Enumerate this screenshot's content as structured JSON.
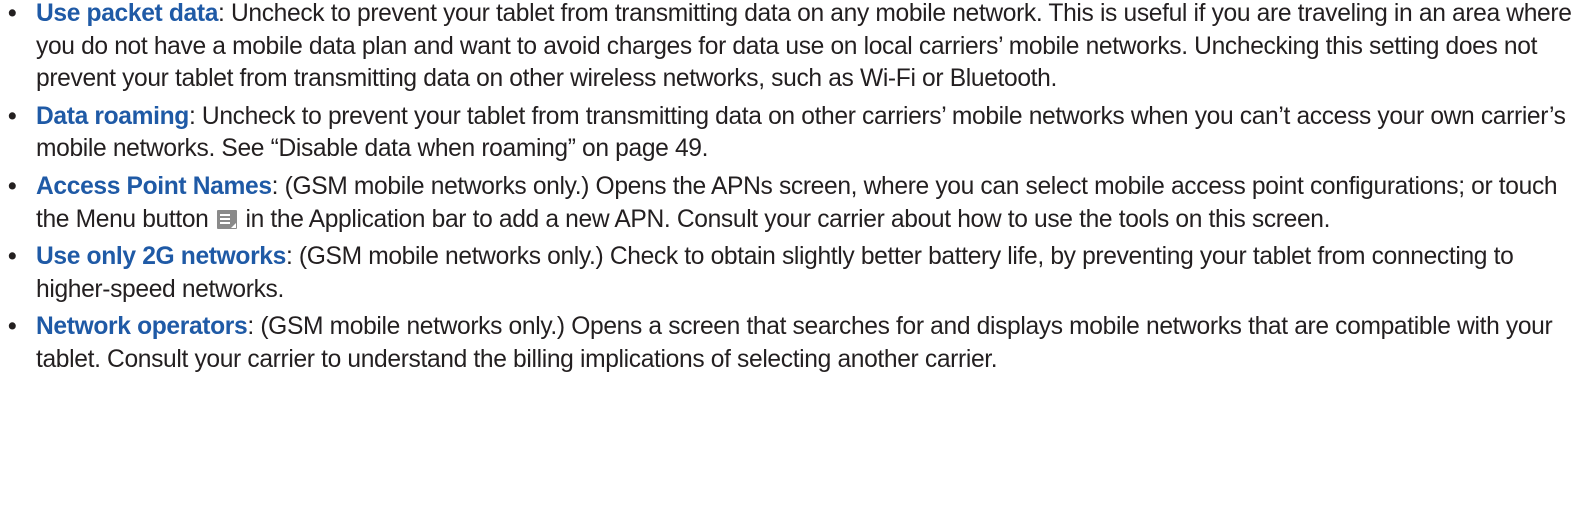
{
  "items": [
    {
      "term": "Use packet data",
      "text": ": Uncheck to prevent your tablet from transmitting data on any mobile network. This is useful if you are traveling in an area where you do not have a mobile data plan and want to avoid charges for data use on local carriers’ mobile networks. Unchecking this setting does not prevent your tablet from transmitting data on other wireless networks, such as Wi-Fi or Bluetooth."
    },
    {
      "term": "Data roaming",
      "text": ": Uncheck to prevent your tablet from transmitting data on other carriers’ mobile networks when you can’t access your own carrier’s mobile networks. See “Disable data when roaming” on page 49."
    },
    {
      "term": "Access Point Names",
      "text_before_icon": ": (GSM mobile networks only.) Opens the APNs screen, where you can select mobile access point configurations; or touch the Menu button ",
      "icon": "menu-icon",
      "text_after_icon": " in the Application bar to add a new APN. Consult your carrier about how to use the tools on this screen."
    },
    {
      "term": "Use only 2G networks",
      "text": ": (GSM mobile networks only.) Check to obtain slightly better battery life, by preventing your tablet from connecting to higher-speed networks."
    },
    {
      "term": "Network operators",
      "text": ": (GSM mobile networks only.) Opens a screen that searches for and displays mobile networks that are compatible with your tablet. Consult your carrier to understand the billing implications of selecting another carrier."
    }
  ],
  "bullet": "•",
  "colors": {
    "term": "#1f5aa6",
    "text": "#231f20"
  }
}
